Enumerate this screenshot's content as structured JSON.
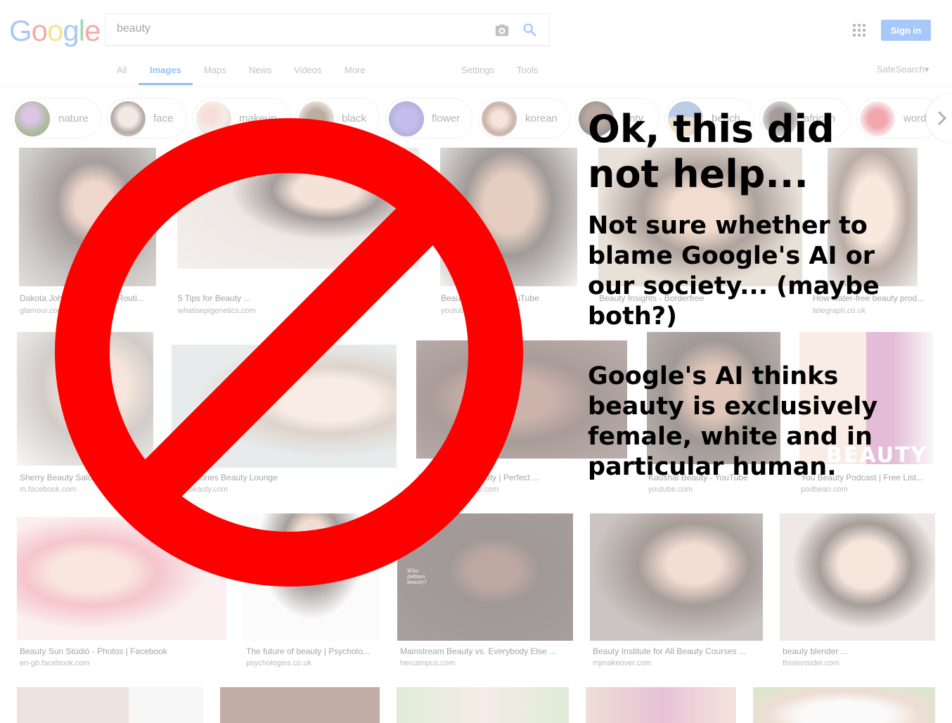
{
  "search": {
    "query": "beauty"
  },
  "header": {
    "signin_label": "Sign in",
    "safesearch_label": "SafeSearch▾"
  },
  "tabs": [
    {
      "label": "All"
    },
    {
      "label": "Images"
    },
    {
      "label": "Maps"
    },
    {
      "label": "News"
    },
    {
      "label": "Videos"
    },
    {
      "label": "More"
    },
    {
      "label": "Settings"
    },
    {
      "label": "Tools"
    }
  ],
  "chips": [
    {
      "label": "nature"
    },
    {
      "label": "face"
    },
    {
      "label": "makeup"
    },
    {
      "label": "black"
    },
    {
      "label": "flower"
    },
    {
      "label": "korean"
    },
    {
      "label": "nty"
    },
    {
      "label": "beach"
    },
    {
      "label": "african"
    },
    {
      "label": "word"
    }
  ],
  "results": [
    {
      "title": "Dakota Johnson's Beauty Routi...",
      "site": "glamour.com"
    },
    {
      "title": "5 Tips for Beauty ...",
      "site": "whatisepigenetics.com"
    },
    {
      "title": "Beauty Routine - YouTube",
      "site": "youtube.com"
    },
    {
      "title": "Beauty Insights - Borderfree",
      "site": ""
    },
    {
      "title": "How water-free beauty prod...",
      "site": "telegraph.co.uk"
    },
    {
      "title": "Sherry Beauty Salon",
      "site": "m.facebook.com"
    },
    {
      "title": "Accessories Beauty Lounge",
      "site": "dori-beauty.com"
    },
    {
      "title": "The Power of Beauty | Perfect ...",
      "site": "permanentmakeup.com"
    },
    {
      "title": "Kaushal Beauty - YouTube",
      "site": "youtube.com"
    },
    {
      "title": "You Beauty Podcast | Free List...",
      "site": "podbean.com"
    },
    {
      "title": "Beauty Sun Stúdió - Photos | Facebook",
      "site": "en-gb.facebook.com"
    },
    {
      "title": "The future of beauty | Psycholo...",
      "site": "psychologies.co.uk"
    },
    {
      "title": "Mainstream Beauty vs. Everybody Else ...",
      "site": "hercampus.com"
    },
    {
      "title": "Beauty Institute for All Beauty Courses ...",
      "site": "mjmakeover.com"
    },
    {
      "title": "beauty blender ...",
      "site": "thisisinsider.com"
    }
  ],
  "image_texts": {
    "banner": "BEAUTY",
    "poster": "Who defines beauty?"
  },
  "meme": {
    "headline": [
      "Ok, this did",
      "not help..."
    ],
    "para1": [
      "Not sure whether to",
      "blame Google's AI or",
      "our society... (maybe",
      "both?)"
    ],
    "para2": [
      "Google's AI thinks",
      "beauty is exclusively",
      "female, white and in",
      "particular human."
    ]
  },
  "colors": {
    "accent": "#4285f4",
    "no_sign": "#ff0000"
  }
}
